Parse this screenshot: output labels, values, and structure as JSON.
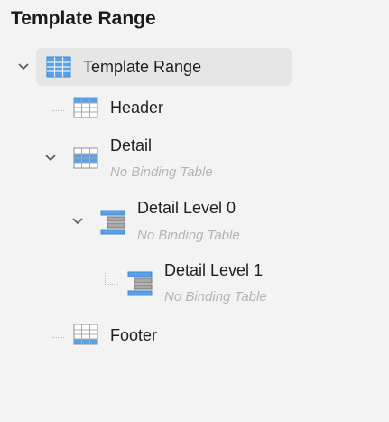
{
  "panel": {
    "title": "Template Range"
  },
  "tree": {
    "root": {
      "label": "Template Range",
      "icon": "table-range-icon",
      "expanded": true
    },
    "header": {
      "label": "Header",
      "icon": "table-header-icon"
    },
    "detail": {
      "label": "Detail",
      "binding": "No Binding Table",
      "icon": "table-detail-icon",
      "expanded": true
    },
    "detail_level_0": {
      "label": "Detail Level 0",
      "binding": "No Binding Table",
      "icon": "detail-level-icon",
      "expanded": true
    },
    "detail_level_1": {
      "label": "Detail Level 1",
      "binding": "No Binding Table",
      "icon": "detail-level-icon"
    },
    "footer": {
      "label": "Footer",
      "icon": "table-footer-icon"
    }
  },
  "colors": {
    "accent_blue": "#5aa0e6",
    "grid_gray": "#9a9a9a",
    "selection_bg": "#e6e6e6"
  }
}
